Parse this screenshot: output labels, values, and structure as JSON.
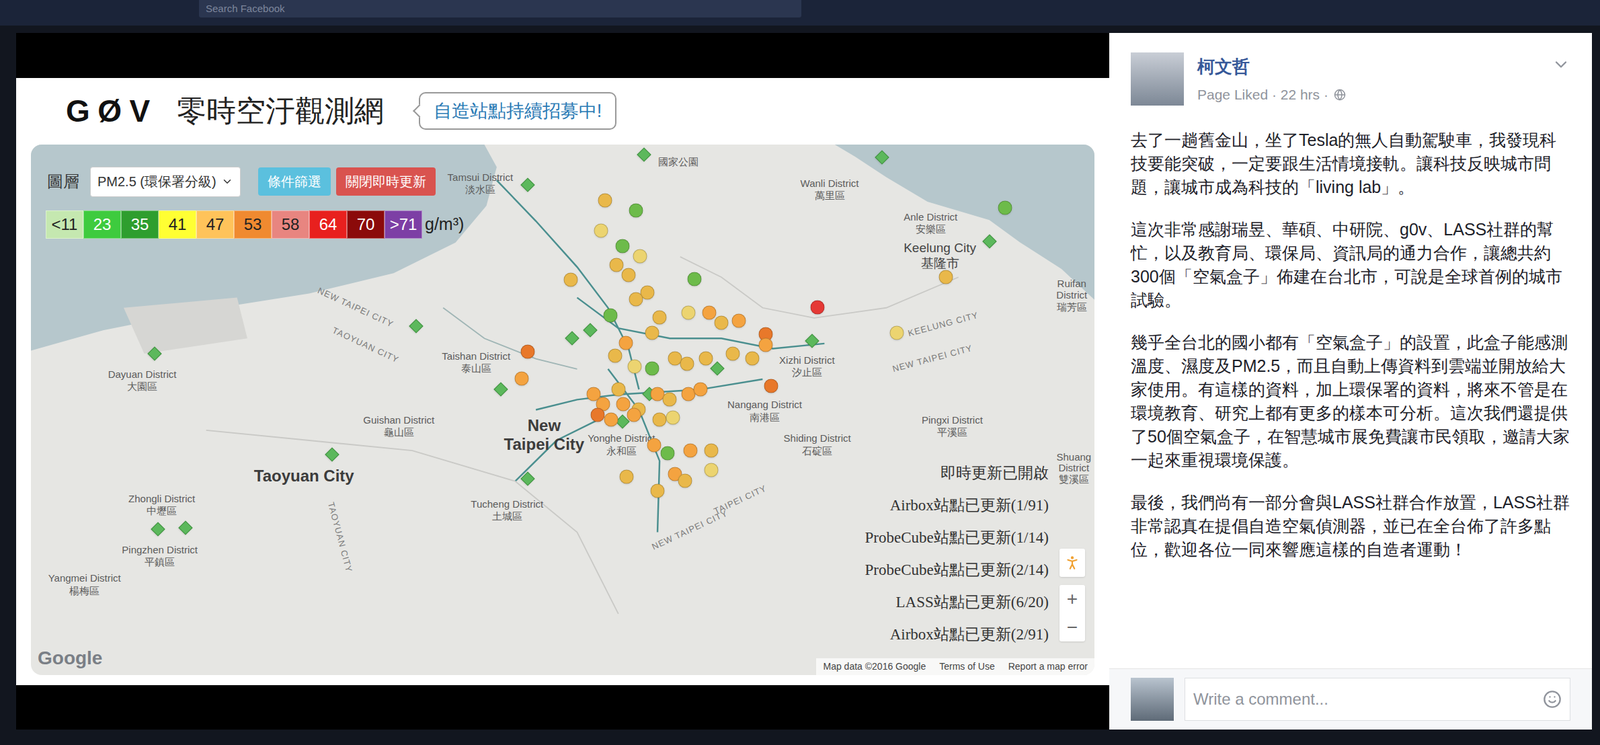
{
  "topbar": {
    "search_placeholder": "Search Facebook"
  },
  "photo": {
    "header": {
      "logo": "GØV",
      "title": "零時空汙觀測網",
      "callout": "自造站點持續招募中!"
    },
    "map": {
      "layer_label": "圖層",
      "layer_select": "PM2.5 (環保署分級)",
      "buttons": [
        {
          "label": "條件篩選",
          "color": "#5bc0de"
        },
        {
          "label": "關閉即時更新",
          "color": "#d9534f"
        }
      ],
      "legend": [
        {
          "label": "<11",
          "color": "#c5e8b0"
        },
        {
          "label": "23",
          "color": "#3ecb3e"
        },
        {
          "label": "35",
          "color": "#2e9e2e"
        },
        {
          "label": "41",
          "color": "#ffff33"
        },
        {
          "label": "47",
          "color": "#ffc35a"
        },
        {
          "label": "53",
          "color": "#f08a30"
        },
        {
          "label": "58",
          "color": "#e88580"
        },
        {
          "label": "64",
          "color": "#e8201e"
        },
        {
          "label": "70",
          "color": "#8b0a0a"
        },
        {
          "label": ">71",
          "color": "#7d3fa5"
        }
      ],
      "legend_unit": "g/m³)",
      "labels": [
        {
          "text": "Tamsui District",
          "kind": "district"
        },
        {
          "text": "淡水區",
          "kind": "district"
        },
        {
          "text": "國家公園",
          "kind": "district"
        },
        {
          "text": "Wanli District",
          "kind": "district"
        },
        {
          "text": "萬里區",
          "kind": "district"
        },
        {
          "text": "Anle District",
          "kind": "district"
        },
        {
          "text": "安樂區",
          "kind": "district"
        },
        {
          "text": "Keelung City",
          "kind": "town"
        },
        {
          "text": "基隆市",
          "kind": "town"
        },
        {
          "text": "Ruifan",
          "kind": "district"
        },
        {
          "text": "District",
          "kind": "district"
        },
        {
          "text": "瑞芳區",
          "kind": "district"
        },
        {
          "text": "NEW TAIPEI CITY",
          "kind": "road"
        },
        {
          "text": "TAOYUAN CITY",
          "kind": "road"
        },
        {
          "text": "Xizhi District",
          "kind": "district"
        },
        {
          "text": "汐止區",
          "kind": "district"
        },
        {
          "text": "KEELUNG CITY",
          "kind": "road"
        },
        {
          "text": "NEW TAIPEI CITY",
          "kind": "road"
        },
        {
          "text": "Taishan District",
          "kind": "district"
        },
        {
          "text": "泰山區",
          "kind": "district"
        },
        {
          "text": "Nangang District",
          "kind": "district"
        },
        {
          "text": "南港區",
          "kind": "district"
        },
        {
          "text": "New",
          "kind": "city"
        },
        {
          "text": "Taipei City",
          "kind": "city"
        },
        {
          "text": "Guishan District",
          "kind": "district"
        },
        {
          "text": "龜山區",
          "kind": "district"
        },
        {
          "text": "Yonghe District",
          "kind": "district"
        },
        {
          "text": "永和區",
          "kind": "district"
        },
        {
          "text": "Pingxi District",
          "kind": "district"
        },
        {
          "text": "平溪區",
          "kind": "district"
        },
        {
          "text": "Shiding District",
          "kind": "district"
        },
        {
          "text": "石碇區",
          "kind": "district"
        },
        {
          "text": "Shuang",
          "kind": "district"
        },
        {
          "text": "District",
          "kind": "district"
        },
        {
          "text": "雙溪區",
          "kind": "district"
        },
        {
          "text": "Taoyuan City",
          "kind": "city"
        },
        {
          "text": "Dayuan District",
          "kind": "district"
        },
        {
          "text": "大園區",
          "kind": "district"
        },
        {
          "text": "Zhongli District",
          "kind": "district"
        },
        {
          "text": "中壢區",
          "kind": "district"
        },
        {
          "text": "Tucheng District",
          "kind": "district"
        },
        {
          "text": "土城區",
          "kind": "district"
        },
        {
          "text": "Pingzhen District",
          "kind": "district"
        },
        {
          "text": "平鎮區",
          "kind": "district"
        },
        {
          "text": "Yangmei District",
          "kind": "district"
        },
        {
          "text": "楊梅區",
          "kind": "district"
        },
        {
          "text": "TAOYUAN CITY",
          "kind": "road"
        },
        {
          "text": "NEW TAIPEI CITY",
          "kind": "road"
        },
        {
          "text": "TAIPEI CITY",
          "kind": "road"
        }
      ],
      "pins": [
        {
          "kind": "diamond",
          "color": "#5cb85c"
        },
        {
          "kind": "diamond",
          "color": "#5cb85c"
        },
        {
          "kind": "diamond",
          "color": "#5cb85c"
        },
        {
          "kind": "diamond",
          "color": "#5cb85c"
        },
        {
          "kind": "diamond",
          "color": "#5cb85c"
        },
        {
          "kind": "diamond",
          "color": "#5cb85c"
        },
        {
          "kind": "diamond",
          "color": "#5cb85c"
        },
        {
          "kind": "diamond",
          "color": "#5cb85c"
        },
        {
          "kind": "diamond",
          "color": "#5cb85c"
        },
        {
          "kind": "diamond",
          "color": "#5cb85c"
        },
        {
          "kind": "diamond",
          "color": "#5cb85c"
        },
        {
          "kind": "diamond",
          "color": "#5cb85c"
        },
        {
          "kind": "diamond",
          "color": "#5cb85c"
        },
        {
          "kind": "diamond",
          "color": "#5cb85c"
        },
        {
          "kind": "diamond",
          "color": "#5cb85c"
        },
        {
          "kind": "diamond",
          "color": "#5cb85c"
        },
        {
          "kind": "diamond",
          "color": "#5cb85c"
        },
        {
          "kind": "circle",
          "color": "#e9b84a"
        },
        {
          "kind": "circle",
          "color": "#6dbb4a"
        },
        {
          "kind": "circle",
          "color": "#ecd470"
        },
        {
          "kind": "circle",
          "color": "#6dbb4a"
        },
        {
          "kind": "circle",
          "color": "#ecd470"
        },
        {
          "kind": "circle",
          "color": "#e9b84a"
        },
        {
          "kind": "circle",
          "color": "#e9b84a"
        },
        {
          "kind": "circle",
          "color": "#e9b84a"
        },
        {
          "kind": "circle",
          "color": "#e9b84a"
        },
        {
          "kind": "circle",
          "color": "#6dbb4a"
        },
        {
          "kind": "circle",
          "color": "#e9b84a"
        },
        {
          "kind": "circle",
          "color": "#6dbb4a"
        },
        {
          "kind": "circle",
          "color": "#e53935"
        },
        {
          "kind": "circle",
          "color": "#ecd470"
        },
        {
          "kind": "circle",
          "color": "#e9b84a"
        },
        {
          "kind": "circle",
          "color": "#6dbb4a"
        },
        {
          "kind": "circle",
          "color": "#ecd470"
        },
        {
          "kind": "circle",
          "color": "#f4a340"
        },
        {
          "kind": "circle",
          "color": "#e9b84a"
        },
        {
          "kind": "circle",
          "color": "#f4a340"
        },
        {
          "kind": "circle",
          "color": "#e8782a"
        },
        {
          "kind": "circle",
          "color": "#f4a340"
        },
        {
          "kind": "circle",
          "color": "#e9b84a"
        },
        {
          "kind": "circle",
          "color": "#e9b84a"
        },
        {
          "kind": "circle",
          "color": "#e9b84a"
        },
        {
          "kind": "circle",
          "color": "#e9b84a"
        },
        {
          "kind": "circle",
          "color": "#f4a340"
        },
        {
          "kind": "circle",
          "color": "#e9b84a"
        },
        {
          "kind": "circle",
          "color": "#ecd470"
        },
        {
          "kind": "circle",
          "color": "#6dbb4a"
        },
        {
          "kind": "circle",
          "color": "#e9b84a"
        },
        {
          "kind": "circle",
          "color": "#e9b84a"
        },
        {
          "kind": "circle",
          "color": "#e9b84a"
        },
        {
          "kind": "circle",
          "color": "#e8782a"
        },
        {
          "kind": "circle",
          "color": "#f4a340"
        },
        {
          "kind": "circle",
          "color": "#e8782a"
        },
        {
          "kind": "circle",
          "color": "#f4a340"
        },
        {
          "kind": "circle",
          "color": "#e9b84a"
        },
        {
          "kind": "circle",
          "color": "#f4a340"
        },
        {
          "kind": "circle",
          "color": "#f4a340"
        },
        {
          "kind": "circle",
          "color": "#e9b84a"
        },
        {
          "kind": "circle",
          "color": "#f4a340"
        },
        {
          "kind": "circle",
          "color": "#e9b84a"
        },
        {
          "kind": "circle",
          "color": "#f4a340"
        },
        {
          "kind": "circle",
          "color": "#f4a340"
        },
        {
          "kind": "circle",
          "color": "#e8782a"
        },
        {
          "kind": "circle",
          "color": "#f4a340"
        },
        {
          "kind": "circle",
          "color": "#f4a340"
        },
        {
          "kind": "circle",
          "color": "#e9b84a"
        },
        {
          "kind": "circle",
          "color": "#ecd470"
        },
        {
          "kind": "circle",
          "color": "#f4a340"
        },
        {
          "kind": "circle",
          "color": "#6dbb4a"
        },
        {
          "kind": "circle",
          "color": "#e9b84a"
        },
        {
          "kind": "circle",
          "color": "#f4a340"
        },
        {
          "kind": "circle",
          "color": "#f4a340"
        },
        {
          "kind": "circle",
          "color": "#e9b84a"
        },
        {
          "kind": "circle",
          "color": "#ecd470"
        },
        {
          "kind": "circle",
          "color": "#e9b84a"
        },
        {
          "kind": "circle",
          "color": "#e9b84a"
        }
      ],
      "status": [
        "即時更新已開啟",
        "Airbox站點已更新(1/91)",
        "ProbeCube站點已更新(1/14)",
        "ProbeCube站點已更新(2/14)",
        "LASS站點已更新(6/20)",
        "Airbox站點已更新(2/91)"
      ],
      "zoom": [
        "+",
        "−"
      ],
      "attribution": {
        "logo": "Google",
        "items": [
          "Map data ©2016 Google",
          "Terms of Use",
          "Report a map error"
        ]
      }
    }
  },
  "post": {
    "author": "柯文哲",
    "meta": "Page Liked · 22 hrs ·",
    "paragraphs": [
      "去了一趟舊金山，坐了Tesla的無人自動駕駛車，我發現科技要能突破，一定要跟生活情境接軌。讓科技反映城市問題，讓城市成為科技的「living lab」。",
      "這次非常感謝瑞昱、華碩、中研院、g0v、LASS社群的幫忙，以及教育局、環保局、資訊局的通力合作，讓總共約300個「空氣盒子」佈建在台北市，可說是全球首例的城市試驗。",
      "幾乎全台北的國小都有「空氣盒子」的設置，此盒子能感測溫度、濕度及PM2.5，而且自動上傳資料到雲端並開放給大家使用。有這樣的資料，加上環保署的資料，將來不管是在環境教育、研究上都有更多的樣本可分析。這次我們還提供了50個空氣盒子，在智慧城市展免費讓市民領取，邀請大家一起來重視環境保護。",
      "最後，我們尚有一部分會與LASS社群合作放置，LASS社群非常認真在提倡自造空氣偵測器，並已在全台佈了許多點位，歡迎各位一同來響應這樣的自造者運動！"
    ]
  },
  "comment": {
    "placeholder": "Write a comment..."
  }
}
